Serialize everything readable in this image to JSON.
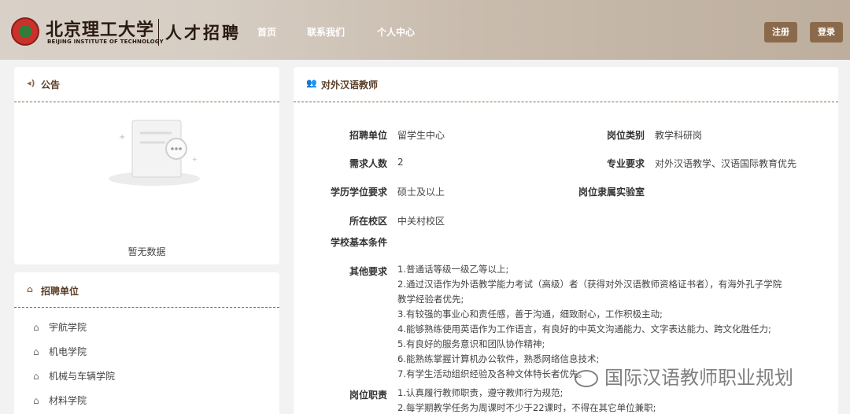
{
  "header": {
    "logo_cn": "北京理工大学",
    "logo_en": "BEIJING INSTITUTE OF TECHNOLOGY",
    "logo_sub": "人才招聘",
    "nav": [
      "首页",
      "联系我们",
      "个人中心"
    ],
    "register_label": "注册",
    "login_label": "登录"
  },
  "notice": {
    "title": "公告",
    "empty_text": "暂无数据"
  },
  "units": {
    "title": "招聘单位",
    "items": [
      "宇航学院",
      "机电学院",
      "机械与车辆学院",
      "材料学院"
    ]
  },
  "job": {
    "title": "对外汉语教师",
    "fields": {
      "unit_label": "招聘单位",
      "unit_value": "留学生中心",
      "category_label": "岗位类别",
      "category_value": "教学科研岗",
      "count_label": "需求人数",
      "count_value": "2",
      "major_label": "专业要求",
      "major_value": "对外汉语教学、汉语国际教育优先",
      "degree_label": "学历学位要求",
      "degree_value": "硕士及以上",
      "lab_label": "岗位隶属实验室",
      "lab_value": "",
      "campus_label": "所在校区",
      "campus_value": "中关村校区",
      "basic_label": "学校基本条件",
      "basic_value": "",
      "other_label": "其他要求",
      "duty_label": "岗位职责"
    },
    "other_requirements": [
      "1.普通话等级一级乙等以上;",
      "2.通过汉语作为外语教学能力考试（高级）者（获得对外汉语教师资格证书者），有海外孔子学院",
      "教学经验者优先;",
      "3.有较强的事业心和责任感，善于沟通，细致耐心，工作积极主动;",
      "4.能够熟练使用英语作为工作语言，有良好的中英文沟通能力、文字表达能力、跨文化胜任力;",
      "5.有良好的服务意识和团队协作精神;",
      "6.能熟练掌握计算机办公软件，熟悉网络信息技术;",
      "7.有学生活动组织经验及各种文体特长者优先。"
    ],
    "duties": [
      "1.认真履行教师职责，遵守教师行为规范;",
      "2.每学期教学任务为周课时不少于22课时，不得在其它单位兼职;"
    ]
  },
  "watermark": {
    "text": "国际汉语教师职业规划"
  },
  "colors": {
    "accent": "#8b6a4c",
    "header_start": "#d9d1c8",
    "header_end": "#bdae9d"
  }
}
